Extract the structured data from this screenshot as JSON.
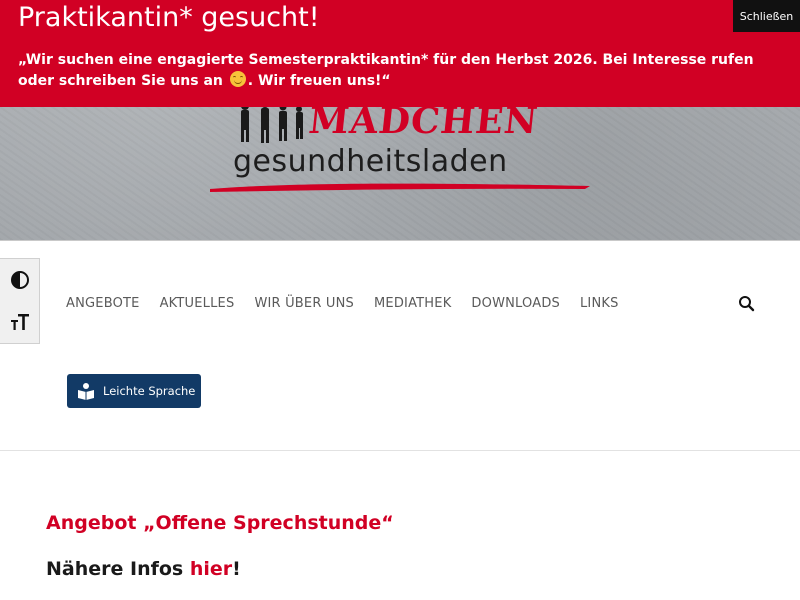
{
  "banner": {
    "title": "Praktikantin* gesucht!",
    "text_before": "„Wir suchen eine engagierte Semesterpraktikantin* für den Herbst 2026. Bei Interesse rufen oder schreiben Sie uns an ",
    "emoji": "smiling-face-emoji",
    "text_after": ". Wir freuen uns!“",
    "close_label": "Schließen",
    "background_color": "#d10024"
  },
  "logo": {
    "word_top": "MÄDCHEN",
    "word_bottom": "gesundheitsladen"
  },
  "a11y": {
    "contrast_icon": "contrast-icon",
    "font_size_icon": "font-size-icon"
  },
  "nav": {
    "items": [
      "ANGEBOTE",
      "AKTUELLES",
      "WIR ÜBER UNS",
      "MEDIATHEK",
      "DOWNLOADS",
      "LINKS"
    ],
    "search_icon": "search-icon"
  },
  "leichte_sprache": {
    "label": "Leichte Sprache",
    "icon": "easy-language-icon",
    "color": "#123a66"
  },
  "content": {
    "heading": "Angebot „Offene Sprechstunde“",
    "info_prefix": "Nähere Infos ",
    "info_link": "hier",
    "info_suffix": "!"
  },
  "accent_color": "#d10024"
}
